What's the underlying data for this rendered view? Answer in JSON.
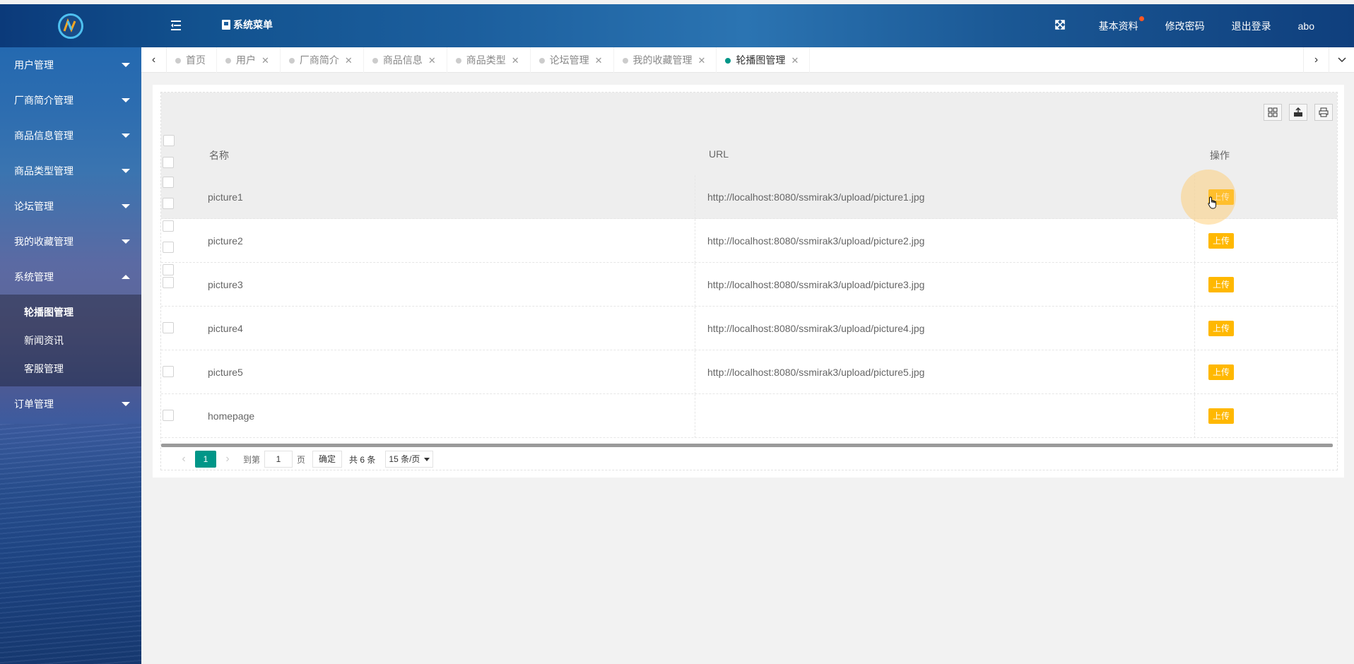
{
  "header": {
    "system_menu": "系统菜单",
    "basic_info": "基本资料",
    "change_password": "修改密码",
    "logout": "退出登录",
    "username": "abo"
  },
  "sidebar": {
    "items": [
      {
        "label": "用户管理"
      },
      {
        "label": "厂商简介管理"
      },
      {
        "label": "商品信息管理"
      },
      {
        "label": "商品类型管理"
      },
      {
        "label": "论坛管理"
      },
      {
        "label": "我的收藏管理"
      },
      {
        "label": "系统管理",
        "expanded": true
      },
      {
        "label": "订单管理"
      }
    ],
    "system_sub": [
      {
        "label": "轮播图管理",
        "active": true
      },
      {
        "label": "新闻资讯"
      },
      {
        "label": "客服管理"
      }
    ]
  },
  "tabs": [
    {
      "label": "首页"
    },
    {
      "label": "用户"
    },
    {
      "label": "厂商简介"
    },
    {
      "label": "商品信息"
    },
    {
      "label": "商品类型"
    },
    {
      "label": "论坛管理"
    },
    {
      "label": "我的收藏管理"
    },
    {
      "label": "轮播图管理",
      "active": true
    }
  ],
  "table": {
    "columns": {
      "name": "名称",
      "url": "URL",
      "action": "操作"
    },
    "upload_label": "上传",
    "rows": [
      {
        "name": "picture1",
        "url": "http://localhost:8080/ssmirak3/upload/picture1.jpg"
      },
      {
        "name": "picture2",
        "url": "http://localhost:8080/ssmirak3/upload/picture2.jpg"
      },
      {
        "name": "picture3",
        "url": "http://localhost:8080/ssmirak3/upload/picture3.jpg"
      },
      {
        "name": "picture4",
        "url": "http://localhost:8080/ssmirak3/upload/picture4.jpg"
      },
      {
        "name": "picture5",
        "url": "http://localhost:8080/ssmirak3/upload/picture5.jpg"
      },
      {
        "name": "homepage",
        "url": ""
      }
    ]
  },
  "pager": {
    "current_page": "1",
    "goto_label": "到第",
    "page_input": "1",
    "page_unit": "页",
    "confirm": "确定",
    "total": "共 6 条",
    "page_size": "15 条/页"
  },
  "colors": {
    "accent": "#009688",
    "upload": "#ffb800",
    "badge": "#ff5722"
  }
}
